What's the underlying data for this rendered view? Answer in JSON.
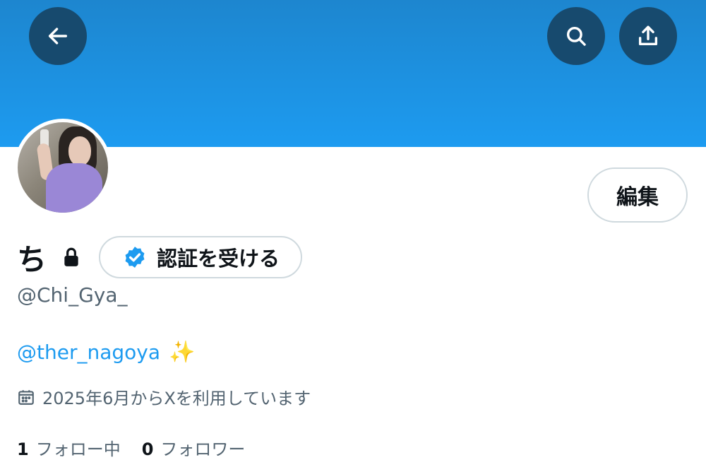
{
  "profile": {
    "display_name": "ち",
    "handle": "@Chi_Gya_",
    "bio_mention": "@ther_nagoya",
    "bio_emoji": "✨",
    "joined_text": "2025年6月からXを利用しています",
    "following_count": "1",
    "following_label": "フォロー中",
    "followers_count": "0",
    "followers_label": "フォロワー"
  },
  "buttons": {
    "edit_label": "編集",
    "verify_label": "認証を受ける"
  },
  "icons": {
    "back": "arrow-left-icon",
    "search": "search-icon",
    "share": "share-icon",
    "lock": "lock-icon",
    "verified": "verified-badge-icon",
    "calendar": "calendar-icon"
  },
  "colors": {
    "banner": "#1d9bf0",
    "icon_button_bg": "#174a6e",
    "link": "#1d9bf0",
    "secondary_text": "#536471",
    "border": "#cfd9de"
  }
}
